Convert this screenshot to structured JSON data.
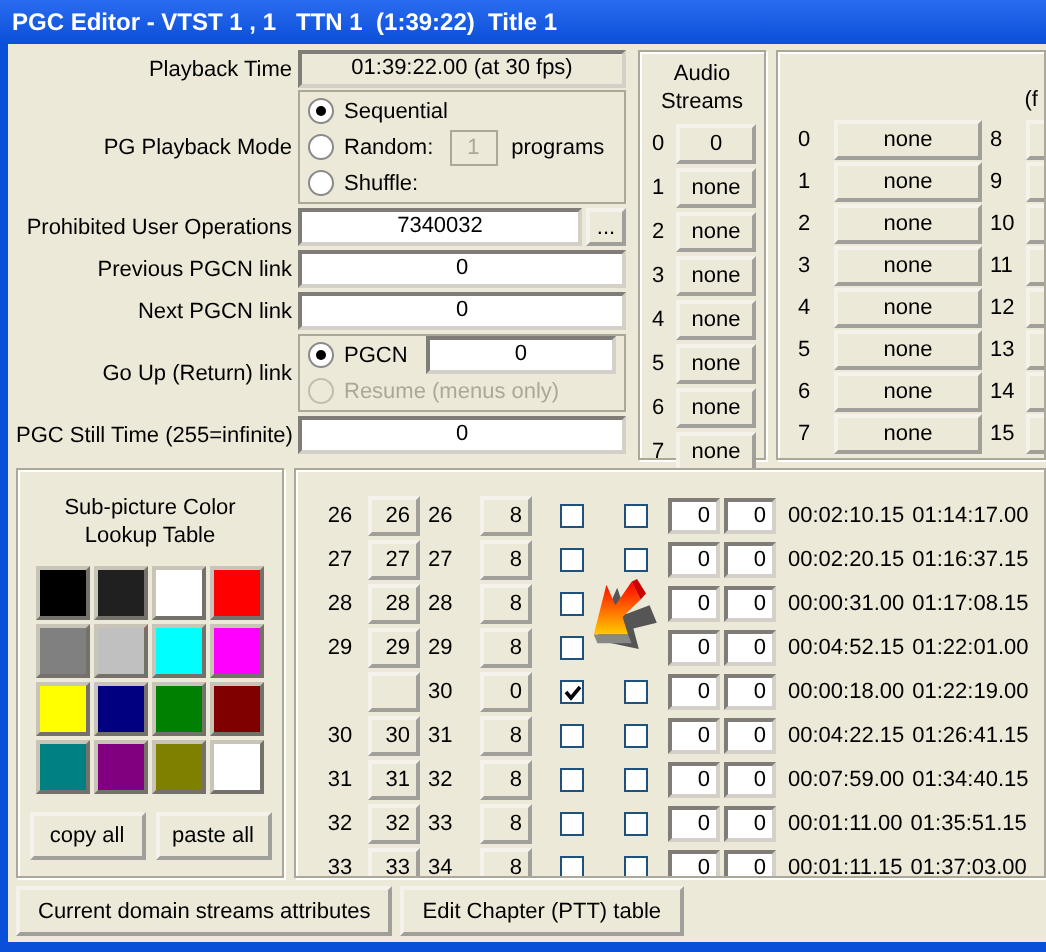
{
  "window": {
    "title": "PGC Editor - VTST 1 , 1   TTN 1  (1:39:22)  Title 1"
  },
  "form": [
    {
      "kind": "readout",
      "label": "Playback Time",
      "value": "01:39:22.00 (at 30 fps)"
    },
    {
      "kind": "mode",
      "label": "PG Playback Mode",
      "options": [
        {
          "label": "Sequential",
          "selected": true
        },
        {
          "label": "Random:",
          "selected": false
        },
        {
          "label": "Shuffle:",
          "selected": false
        }
      ],
      "count": "1",
      "unit": "programs"
    },
    {
      "kind": "field-button",
      "label": "Prohibited User Operations",
      "value": "7340032",
      "button": "..."
    },
    {
      "kind": "field",
      "label": "Previous PGCN link",
      "value": "0"
    },
    {
      "kind": "field",
      "label": "Next PGCN link",
      "value": "0"
    },
    {
      "kind": "return",
      "label": "Go Up (Return) link",
      "options": [
        {
          "label": "PGCN",
          "selected": true,
          "disabled": false
        },
        {
          "label": "Resume (menus only)",
          "selected": false,
          "disabled": true
        }
      ],
      "value": "0"
    },
    {
      "kind": "field",
      "label": "PGC Still Time (255=infinite)",
      "value": "0"
    }
  ],
  "audio": {
    "title": "Audio Streams",
    "streams": [
      {
        "index": "0",
        "value": "0"
      },
      {
        "index": "1",
        "value": "none"
      },
      {
        "index": "2",
        "value": "none"
      },
      {
        "index": "3",
        "value": "none"
      },
      {
        "index": "4",
        "value": "none"
      },
      {
        "index": "5",
        "value": "none"
      },
      {
        "index": "6",
        "value": "none"
      },
      {
        "index": "7",
        "value": "none"
      }
    ]
  },
  "subpicture": {
    "title": "(f",
    "left": [
      {
        "index": "0",
        "value": "none"
      },
      {
        "index": "1",
        "value": "none"
      },
      {
        "index": "2",
        "value": "none"
      },
      {
        "index": "3",
        "value": "none"
      },
      {
        "index": "4",
        "value": "none"
      },
      {
        "index": "5",
        "value": "none"
      },
      {
        "index": "6",
        "value": "none"
      },
      {
        "index": "7",
        "value": "none"
      }
    ],
    "right": [
      {
        "index": "8"
      },
      {
        "index": "9"
      },
      {
        "index": "10"
      },
      {
        "index": "11"
      },
      {
        "index": "12"
      },
      {
        "index": "13"
      },
      {
        "index": "14"
      },
      {
        "index": "15"
      }
    ]
  },
  "color_table": {
    "title": "Sub-picture Color Lookup Table",
    "swatches": [
      {
        "color": "#000000"
      },
      {
        "color": "#202020"
      },
      {
        "color": "#ffffff"
      },
      {
        "color": "#ff0000"
      },
      {
        "color": "#808080"
      },
      {
        "color": "#c0c0c0"
      },
      {
        "color": "#00ffff"
      },
      {
        "color": "#ff00ff"
      },
      {
        "color": "#ffff00"
      },
      {
        "color": "#000080"
      },
      {
        "color": "#008000"
      },
      {
        "color": "#800000"
      },
      {
        "color": "#008080"
      },
      {
        "color": "#800080"
      },
      {
        "color": "#808000"
      },
      {
        "color": "#ffffff"
      }
    ],
    "buttons": [
      "copy all",
      "paste all"
    ]
  },
  "chapters": [
    {
      "number": "26",
      "program": "26",
      "cell": "26",
      "angle": "8",
      "check_1": false,
      "check_2": false,
      "field_1": "0",
      "field_2": "0",
      "duration": "00:02:10.15",
      "start": "01:14:17.00"
    },
    {
      "number": "27",
      "program": "27",
      "cell": "27",
      "angle": "8",
      "check_1": false,
      "check_2": false,
      "field_1": "0",
      "field_2": "0",
      "duration": "00:02:20.15",
      "start": "01:16:37.15"
    },
    {
      "number": "28",
      "program": "28",
      "cell": "28",
      "angle": "8",
      "check_1": false,
      "field_1": "0",
      "field_2": "0",
      "duration": "00:00:31.00",
      "start": "01:17:08.15"
    },
    {
      "number": "29",
      "program": "29",
      "cell": "29",
      "angle": "8",
      "check_1": false,
      "field_1": "0",
      "field_2": "0",
      "duration": "00:04:52.15",
      "start": "01:22:01.00"
    },
    {
      "cell": "30",
      "angle": "0",
      "check_1": true,
      "check_2": false,
      "field_1": "0",
      "field_2": "0",
      "duration": "00:00:18.00",
      "start": "01:22:19.00"
    },
    {
      "number": "30",
      "program": "30",
      "cell": "31",
      "angle": "8",
      "check_1": false,
      "check_2": false,
      "field_1": "0",
      "field_2": "0",
      "duration": "00:04:22.15",
      "start": "01:26:41.15"
    },
    {
      "number": "31",
      "program": "31",
      "cell": "32",
      "angle": "8",
      "check_1": false,
      "check_2": false,
      "field_1": "0",
      "field_2": "0",
      "duration": "00:07:59.00",
      "start": "01:34:40.15"
    },
    {
      "number": "32",
      "program": "32",
      "cell": "33",
      "angle": "8",
      "check_1": false,
      "check_2": false,
      "field_1": "0",
      "field_2": "0",
      "duration": "00:01:11.00",
      "start": "01:35:51.15"
    },
    {
      "number": "33",
      "program": "33",
      "cell": "34",
      "angle": "8",
      "check_1": false,
      "check_2": false,
      "field_1": "0",
      "field_2": "0",
      "duration": "00:01:11.15",
      "start": "01:37:03.00"
    }
  ],
  "buttons": [
    "Current domain streams attributes",
    "Edit Chapter (PTT) table"
  ]
}
